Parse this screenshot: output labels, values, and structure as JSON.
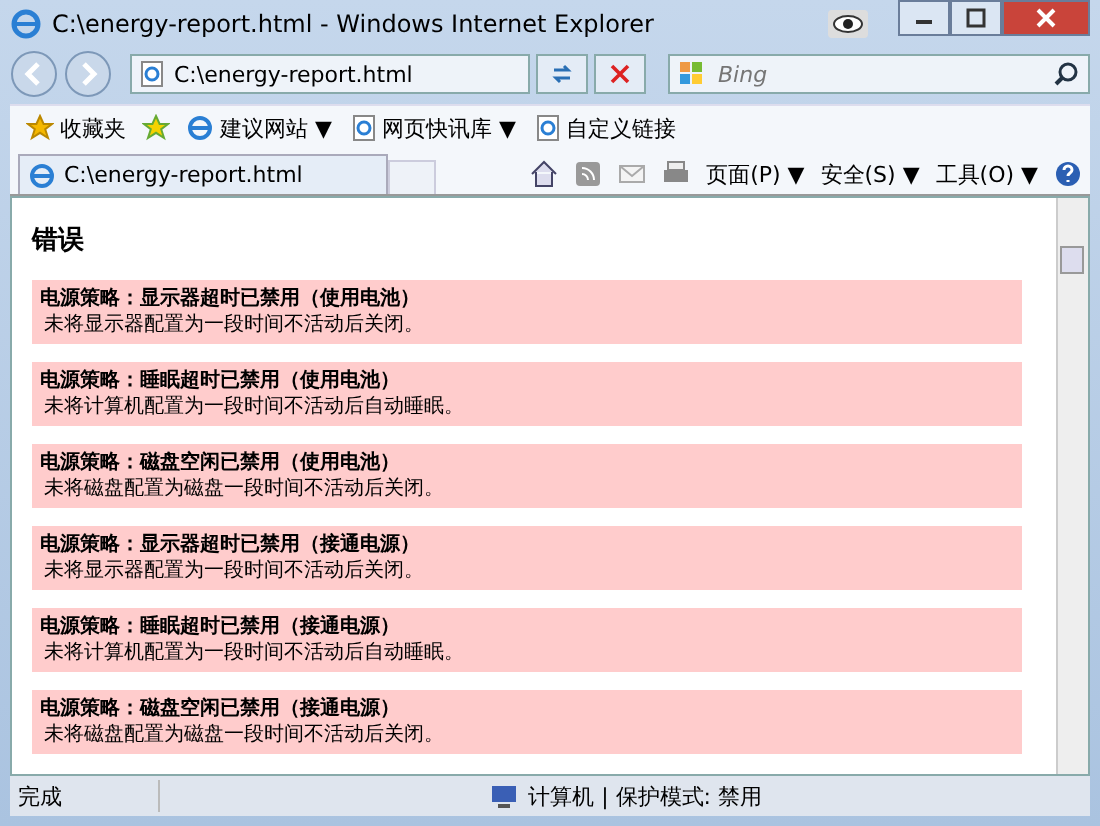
{
  "window": {
    "title": "C:\\energy-report.html - Windows Internet Explorer"
  },
  "address_bar": {
    "value": "C:\\energy-report.html"
  },
  "search": {
    "placeholder": "Bing"
  },
  "favorites_bar": {
    "items": [
      {
        "label": "收藏夹",
        "kind": "star"
      },
      {
        "label": "建议网站 ▼",
        "kind": "ie"
      },
      {
        "label": "网页快讯库 ▼",
        "kind": "page"
      },
      {
        "label": "自定义链接",
        "kind": "page"
      }
    ]
  },
  "tab": {
    "title": "C:\\energy-report.html"
  },
  "command_bar": [
    "页面(P) ▼",
    "安全(S) ▼",
    "工具(O) ▼"
  ],
  "page": {
    "heading": "错误",
    "errors": [
      {
        "title": "电源策略：显示器超时已禁用（使用电池）",
        "detail": "未将显示器配置为一段时间不活动后关闭。"
      },
      {
        "title": "电源策略：睡眠超时已禁用（使用电池）",
        "detail": "未将计算机配置为一段时间不活动后自动睡眠。"
      },
      {
        "title": "电源策略：磁盘空闲已禁用（使用电池）",
        "detail": "未将磁盘配置为磁盘一段时间不活动后关闭。"
      },
      {
        "title": "电源策略：显示器超时已禁用（接通电源）",
        "detail": "未将显示器配置为一段时间不活动后关闭。"
      },
      {
        "title": "电源策略：睡眠超时已禁用（接通电源）",
        "detail": "未将计算机配置为一段时间不活动后自动睡眠。"
      },
      {
        "title": "电源策略：磁盘空闲已禁用（接通电源）",
        "detail": "未将磁盘配置为磁盘一段时间不活动后关闭。"
      }
    ]
  },
  "status_bar": {
    "status": "完成",
    "zone": "计算机 | 保护模式: 禁用"
  }
}
